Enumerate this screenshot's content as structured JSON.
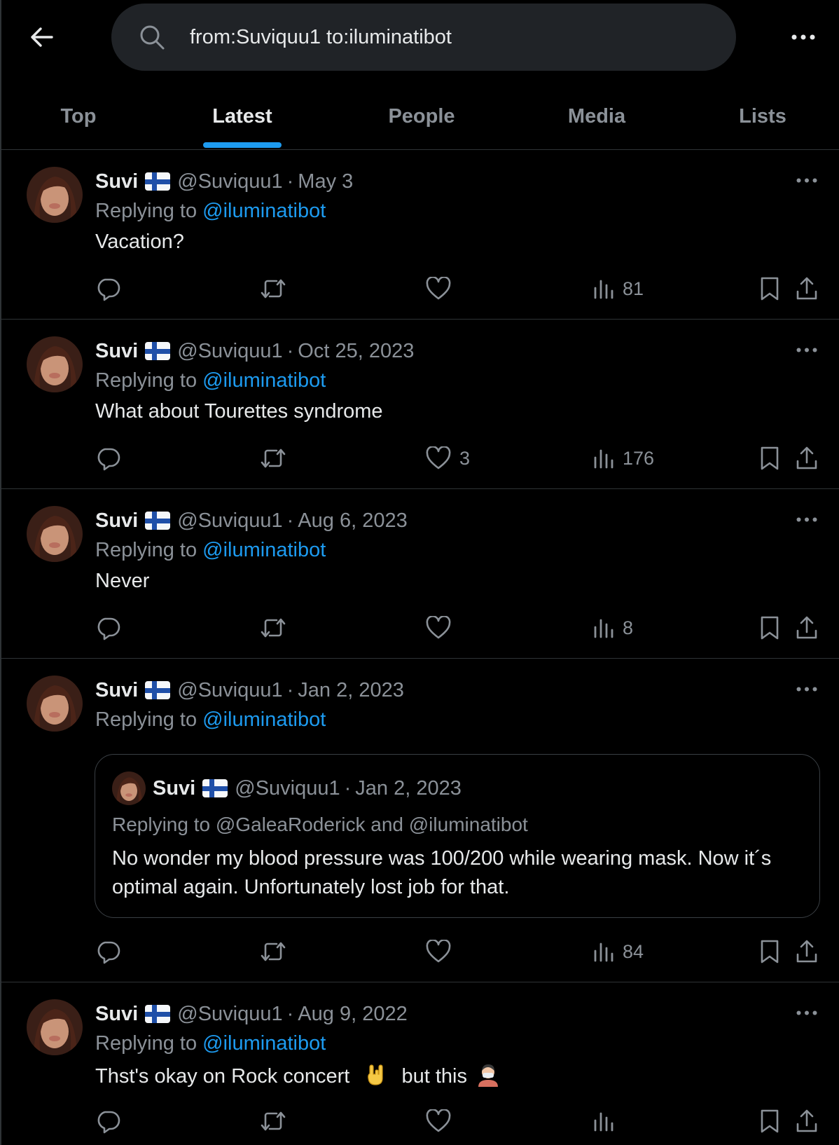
{
  "search": {
    "query": "from:Suviquu1 to:iluminatibot"
  },
  "tabs": [
    {
      "label": "Top"
    },
    {
      "label": "Latest"
    },
    {
      "label": "People"
    },
    {
      "label": "Media"
    },
    {
      "label": "Lists"
    }
  ],
  "active_tab": "Latest",
  "colors": {
    "accent": "#1d9bf0",
    "background": "#000000",
    "muted": "#8b9198",
    "text": "#e7e9ea",
    "divider": "#2f3336"
  },
  "tweets": [
    {
      "name": "Suvi",
      "handle": "@Suviquu1",
      "dot": "·",
      "date": "May 3",
      "replying_prefix": "Replying to",
      "replying_to": "@iluminatibot",
      "text": "Vacation?",
      "likes": "",
      "views": "81"
    },
    {
      "name": "Suvi",
      "handle": "@Suviquu1",
      "dot": "·",
      "date": "Oct 25, 2023",
      "replying_prefix": "Replying to",
      "replying_to": "@iluminatibot",
      "text": "What about Tourettes syndrome",
      "likes": "3",
      "views": "176"
    },
    {
      "name": "Suvi",
      "handle": "@Suviquu1",
      "dot": "·",
      "date": "Aug 6, 2023",
      "replying_prefix": "Replying to",
      "replying_to": "@iluminatibot",
      "text": "Never",
      "likes": "",
      "views": "8"
    },
    {
      "name": "Suvi",
      "handle": "@Suviquu1",
      "dot": "·",
      "date": "Jan 2, 2023",
      "replying_prefix": "Replying to",
      "replying_to": "@iluminatibot",
      "text": "",
      "likes": "",
      "views": "84",
      "quote": {
        "name": "Suvi",
        "handle": "@Suviquu1",
        "dot": "·",
        "date": "Jan 2, 2023",
        "replying": "Replying to @GaleaRoderick and @iluminatibot",
        "text": "No wonder my blood pressure was 100/200 while wearing mask. Now it´s optimal again. Unfortunately lost job for that."
      }
    },
    {
      "name": "Suvi",
      "handle": "@Suviquu1",
      "dot": "·",
      "date": "Aug 9, 2022",
      "replying_prefix": "Replying to",
      "replying_to": "@iluminatibot",
      "text_part1": "Thst's okay on Rock concert",
      "text_part2": "but this",
      "emoji1": "rock-hand-emoji",
      "emoji2": "person-with-mask-emoji",
      "likes": "",
      "views": ""
    }
  ],
  "icons": {
    "back": "arrow-left-icon",
    "search": "search-icon",
    "more": "more-horizontal-icon",
    "flag": "finland-flag-icon",
    "reply": "reply-icon",
    "retweet": "retweet-icon",
    "like": "heart-icon",
    "views": "views-icon",
    "bookmark": "bookmark-icon",
    "share": "share-icon"
  }
}
